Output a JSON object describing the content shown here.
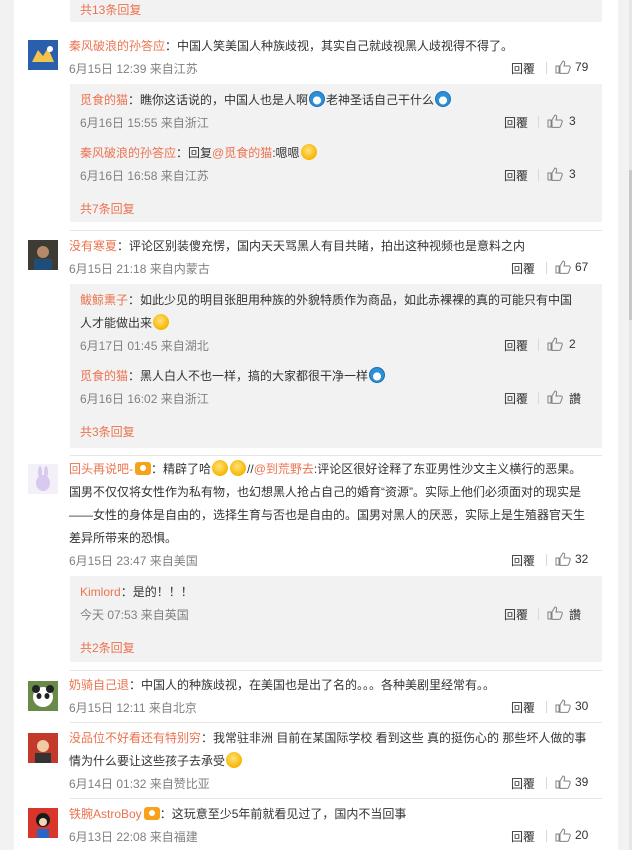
{
  "top_more": "共13条回复",
  "reply_label": "回覆",
  "comments": [
    {
      "name": "秦风破浪的孙答应",
      "text": "：中国人笑美国人种族歧视，其实自己就歧视黑人歧视得不得了。",
      "meta": "6月15日 12:39 来自江苏",
      "likes": "79",
      "replies": [
        {
          "name": "觅食的猫",
          "text": "：瞧你这话说的，中国人也是人啊",
          "text2": "老神圣话自己干什么",
          "meta": "6月16日 15:55 来自浙江",
          "likes": "3"
        },
        {
          "name": "秦风破浪的孙答应",
          "text": "：回复",
          "mention": "@觅食的猫",
          "text2": ":嗯嗯",
          "meta": "6月16日 16:58 来自江苏",
          "likes": "3"
        }
      ],
      "more": "共7条回复"
    },
    {
      "name": "没有寒夏",
      "text": "：评论区别装傻充愣，国内天天骂黑人有目共睹，拍出这种视频也是意料之内",
      "meta": "6月15日 21:18 来自内蒙古",
      "likes": "67",
      "replies": [
        {
          "name": "鲅鲸熏子",
          "text": "：如此少见的明目张胆用种族的外貌特质作为商品，如此赤裸裸的真的可能只有中国",
          "text2": "人才能做出来",
          "meta": "6月17日 01:45 来自湖北",
          "likes": "2"
        },
        {
          "name": "觅食的猫",
          "text": "：黑人白人不也一样，搞的大家都很干净一样",
          "meta": "6月16日 16:02 来自浙江",
          "likes": "讚"
        }
      ],
      "more": "共3条回复"
    },
    {
      "name": "回头再说吧-",
      "text_a": "：精辟了哈",
      "text_b": "//",
      "mention": "@到荒野去",
      "text_c": ":评论区很好诠释了东亚男性沙文主义横行的恶果。",
      "line2": "国男不仅仅将女性作为私有物，也幻想黑人抢占自己的婚育“资源”。实际上他们必须面对的现实是",
      "line3": "——女性的身体是自由的，选择生育与否也是自由的。国男对黑人的厌恶，实际上是生殖器官天生",
      "line4": "差异所带来的恐惧。",
      "meta": "6月15日 23:47 来自美国",
      "likes": "32",
      "replies": [
        {
          "name": "Kimlord",
          "text": "：是的！！！",
          "meta": "今天 07:53 来自英国",
          "likes": "讚"
        }
      ],
      "more": "共2条回复"
    },
    {
      "name": "奶骑自己退",
      "text": "：中国人的种族歧视，在美国也是出了名的。。。各种美剧里经常有。。",
      "meta": "6月15日 12:11 来自北京",
      "likes": "30"
    },
    {
      "name": "没品位不好看还有特别穷",
      "text": "：我常驻非洲 目前在某国际学校 看到这些 真的挺伤心的 那些坏人做的事",
      "line2": "情为什么要让这些孩子去承受",
      "meta": "6月14日 01:32 来自赞比亚",
      "likes": "39"
    },
    {
      "name": "铁腕AstroBoy",
      "text": "：这玩意至少5年前就看见过了，国内不当回事",
      "meta": "6月13日 22:08 来自福建",
      "likes": "20"
    }
  ],
  "colors": {
    "name": "#eb7350",
    "meta": "#808080",
    "subbox": "#f2f2f2"
  }
}
